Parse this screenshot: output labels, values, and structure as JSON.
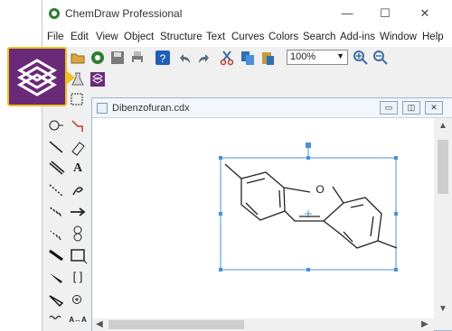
{
  "app": {
    "title": "ChemDraw Professional"
  },
  "window_controls": {
    "minimize": "—",
    "maximize": "☐",
    "close": "✕"
  },
  "menu": [
    "File",
    "Edit",
    "View",
    "Object",
    "Structure",
    "Text",
    "Curves",
    "Colors",
    "Search",
    "Add-ins",
    "Window",
    "Help"
  ],
  "toolbar": {
    "zoom_value": "100%",
    "zoom_options": [
      "100%"
    ]
  },
  "document": {
    "title": "Dibenzofuran.cdx",
    "atom_label": "O"
  },
  "palette": {
    "text_tool": "A",
    "bracket_tool": "[ ]",
    "resize_tool": "A↔A"
  },
  "colors": {
    "accent": "#2f7dd1",
    "badge": "#6a2a78",
    "badge_border": "#f0c020",
    "selection": "#4a90d9"
  }
}
